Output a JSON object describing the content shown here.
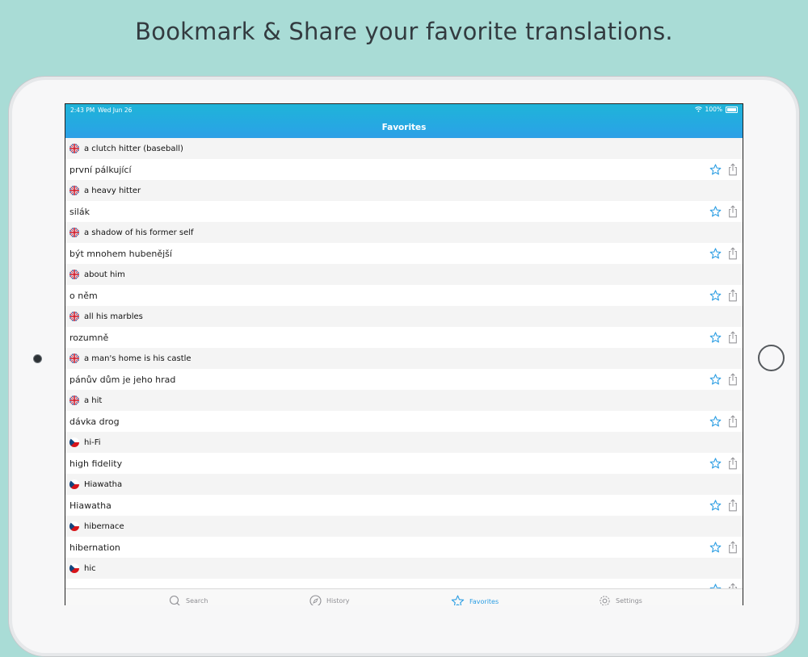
{
  "caption": "Bookmark & Share your favorite translations.",
  "status_bar": {
    "time": "2:43 PM",
    "date": "Wed Jun 26",
    "battery": "100%"
  },
  "nav": {
    "title": "Favorites"
  },
  "colors": {
    "accent": "#2a9de3",
    "nav_top": "#1fb4d8",
    "nav_bottom": "#2d9fe6",
    "background": "#a9dcd6"
  },
  "favorites": [
    {
      "source_lang": "en",
      "source": "a clutch hitter (baseball)",
      "translation": "první pálkující"
    },
    {
      "source_lang": "en",
      "source": "a heavy hitter",
      "translation": "silák"
    },
    {
      "source_lang": "en",
      "source": "a shadow of his former self",
      "translation": "být mnohem hubenější"
    },
    {
      "source_lang": "en",
      "source": "about him",
      "translation": "o něm"
    },
    {
      "source_lang": "en",
      "source": "all his marbles",
      "translation": "rozumně"
    },
    {
      "source_lang": "en",
      "source": "a man's home is his castle",
      "translation": "pánův dům je jeho hrad"
    },
    {
      "source_lang": "en",
      "source": "a hit",
      "translation": "dávka drog"
    },
    {
      "source_lang": "cz",
      "source": "hi-Fi",
      "translation": "high fidelity"
    },
    {
      "source_lang": "cz",
      "source": "Hiawatha",
      "translation": "Hiawatha"
    },
    {
      "source_lang": "cz",
      "source": "hibernace",
      "translation": "hibernation"
    },
    {
      "source_lang": "cz",
      "source": "hic",
      "translation": ""
    }
  ],
  "icons": {
    "favorite": "star-outline-icon",
    "share": "share-icon",
    "flag_en": "uk-flag-icon",
    "flag_cz": "czech-flag-icon"
  },
  "tabs": [
    {
      "label": "Search",
      "icon": "search-icon",
      "active": false
    },
    {
      "label": "History",
      "icon": "compass-icon",
      "active": false
    },
    {
      "label": "Favorites",
      "icon": "star-icon",
      "active": true
    },
    {
      "label": "Settings",
      "icon": "gear-icon",
      "active": false
    }
  ]
}
